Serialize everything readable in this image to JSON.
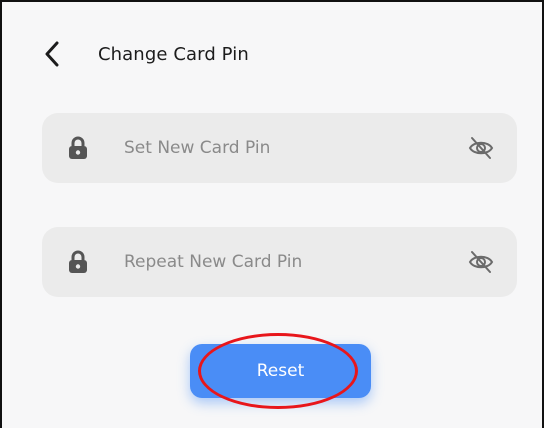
{
  "header": {
    "title": "Change Card Pin",
    "back_icon": "chevron-left-icon"
  },
  "fields": [
    {
      "placeholder": "Set New Card Pin",
      "value": "",
      "leading_icon": "lock-icon",
      "trailing_icon": "eye-off-icon"
    },
    {
      "placeholder": "Repeat New Card Pin",
      "value": "",
      "leading_icon": "lock-icon",
      "trailing_icon": "eye-off-icon"
    }
  ],
  "actions": {
    "reset_label": "Reset"
  },
  "colors": {
    "primary": "#4a8df6",
    "field_background": "#ebebeb",
    "annotation": "#e8161b"
  }
}
